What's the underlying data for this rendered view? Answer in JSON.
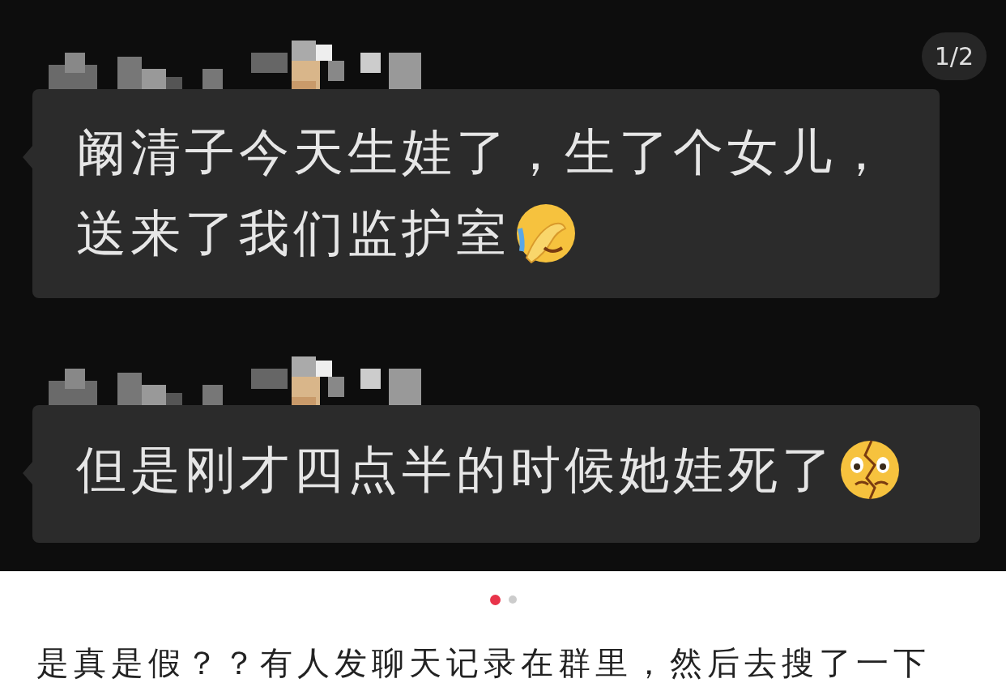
{
  "image_viewer": {
    "page_counter": "1/2",
    "messages": [
      {
        "lines": [
          "阚清子今天生娃了，生了个女儿，",
          "送来了我们监护室"
        ],
        "kind": "facepalm"
      },
      {
        "lines": [
          "但是刚才四点半的时候她娃死了"
        ],
        "kind": "broken-face"
      }
    ]
  },
  "pager_dots": [
    {
      "selected": true
    },
    {
      "selected": false
    }
  ],
  "caption": "是真是假？？有人发聊天记录在群里，然后去搜了一下"
}
